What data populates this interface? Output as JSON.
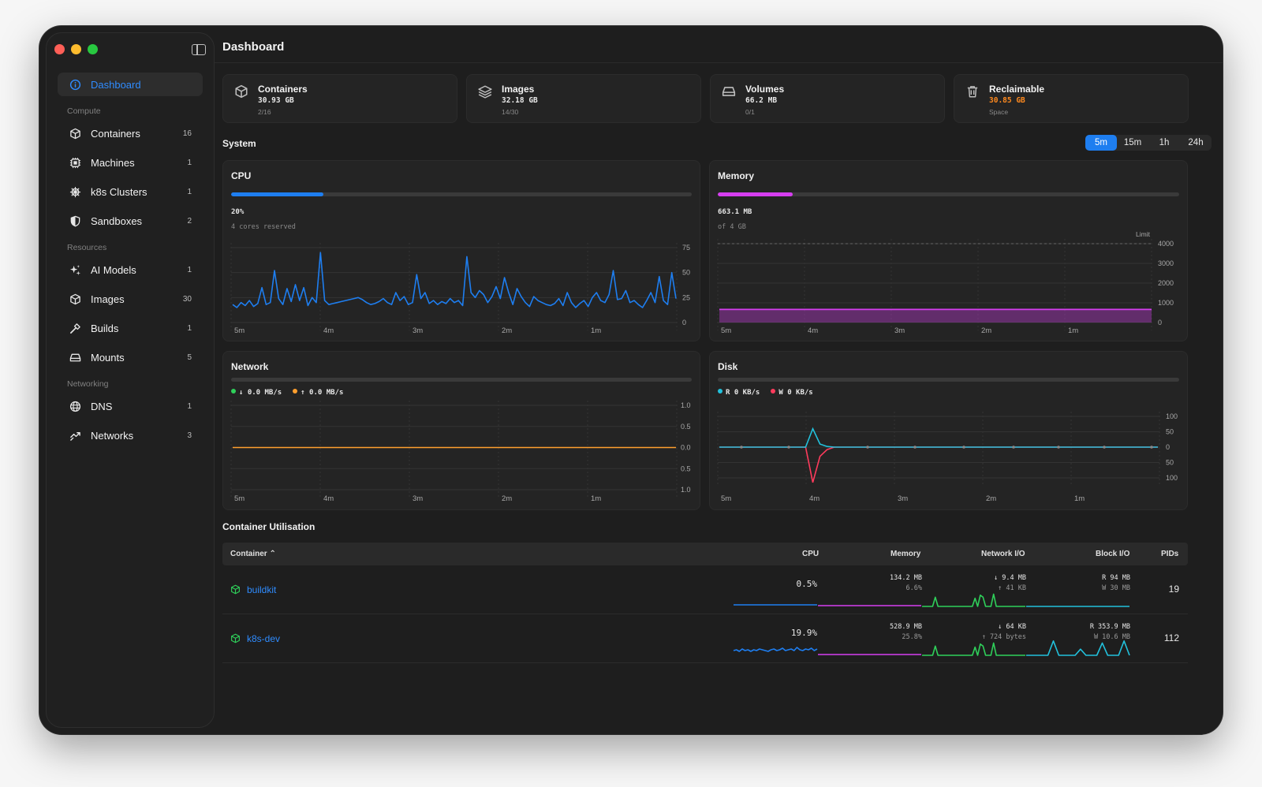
{
  "window": {
    "traffic_colors": [
      "#ff5f57",
      "#febc2e",
      "#28c840"
    ]
  },
  "sidebar": {
    "items": [
      {
        "key": "dashboard",
        "label": "Dashboard",
        "icon": "info-circle-icon",
        "count": "",
        "active": true
      }
    ],
    "sections": [
      {
        "title": "Compute",
        "items": [
          {
            "label": "Containers",
            "icon": "cube-icon",
            "count": "16"
          },
          {
            "label": "Machines",
            "icon": "chip-icon",
            "count": "1"
          },
          {
            "label": "k8s Clusters",
            "icon": "helm-wheel-icon",
            "count": "1"
          },
          {
            "label": "Sandboxes",
            "icon": "shield-icon",
            "count": "2"
          }
        ]
      },
      {
        "title": "Resources",
        "items": [
          {
            "label": "AI Models",
            "icon": "sparkles-icon",
            "count": "1"
          },
          {
            "label": "Images",
            "icon": "cube-outline-icon",
            "count": "30"
          },
          {
            "label": "Builds",
            "icon": "hammer-icon",
            "count": "1"
          },
          {
            "label": "Mounts",
            "icon": "drive-icon",
            "count": "5"
          }
        ]
      },
      {
        "title": "Networking",
        "items": [
          {
            "label": "DNS",
            "icon": "globe-icon",
            "count": "1"
          },
          {
            "label": "Networks",
            "icon": "network-arrows-icon",
            "count": "3"
          }
        ]
      }
    ]
  },
  "page": {
    "title": "Dashboard"
  },
  "stats": [
    {
      "title": "Containers",
      "value": "30.93 GB",
      "sub": "2/16",
      "icon": "cube-icon",
      "value_color": "#e8e8e8"
    },
    {
      "title": "Images",
      "value": "32.18 GB",
      "sub": "14/30",
      "icon": "layers-icon",
      "value_color": "#e8e8e8"
    },
    {
      "title": "Volumes",
      "value": "66.2 MB",
      "sub": "0/1",
      "icon": "drive-icon",
      "value_color": "#e8e8e8"
    },
    {
      "title": "Reclaimable",
      "value": "30.85 GB",
      "sub": "Space",
      "icon": "trash-icon",
      "value_color": "#ff8a1f"
    }
  ],
  "system": {
    "title": "System",
    "ranges": [
      "5m",
      "15m",
      "1h",
      "24h"
    ],
    "active_range": "5m",
    "time_ticks": [
      "5m",
      "4m",
      "3m",
      "2m",
      "1m"
    ]
  },
  "cpu": {
    "title": "CPU",
    "value": "20%",
    "sub": "4 cores reserved",
    "usage": 0.2,
    "color": "#1e7ef0",
    "chart_data": {
      "type": "line",
      "y_ticks": [
        "75",
        "50",
        "25",
        "0"
      ],
      "ylim": [
        0,
        75
      ],
      "values": [
        18,
        15,
        20,
        17,
        22,
        16,
        19,
        35,
        18,
        20,
        52,
        24,
        18,
        34,
        21,
        38,
        22,
        35,
        17,
        25,
        20,
        70,
        22,
        18,
        19,
        20,
        21,
        22,
        23,
        24,
        25,
        23,
        20,
        18,
        19,
        21,
        24,
        20,
        18,
        30,
        22,
        26,
        18,
        20,
        48,
        24,
        30,
        19,
        22,
        18,
        21,
        19,
        24,
        20,
        22,
        17,
        66,
        30,
        25,
        32,
        28,
        20,
        26,
        36,
        24,
        45,
        30,
        18,
        34,
        26,
        20,
        16,
        26,
        22,
        20,
        18,
        17,
        19,
        24,
        17,
        30,
        20,
        15,
        19,
        22,
        16,
        25,
        30,
        22,
        20,
        28,
        52,
        23,
        24,
        32,
        20,
        22,
        18,
        15,
        22,
        30,
        20,
        46,
        22,
        18,
        50,
        24
      ]
    }
  },
  "memory": {
    "title": "Memory",
    "value": "663.1 MB",
    "sub": "of 4 GB",
    "usage": 0.162,
    "color": "#d63ef0",
    "chart_data": {
      "type": "area",
      "y_ticks": [
        "4000",
        "3000",
        "2000",
        "1000",
        "0"
      ],
      "ylim": [
        0,
        4000
      ],
      "limit_label": "Limit",
      "limit": 4000,
      "values": [
        663.1,
        663.1
      ]
    }
  },
  "network": {
    "title": "Network",
    "legend": [
      {
        "label": "↓ 0.0 MB/s",
        "color": "#2fd05a"
      },
      {
        "label": "↑ 0.0 MB/s",
        "color": "#ff9f2e"
      }
    ],
    "chart_data": {
      "type": "line",
      "y_ticks": [
        "1.0",
        "0.5",
        "0.0",
        "0.5",
        "1.0"
      ],
      "ylim": [
        -1,
        1
      ],
      "series": [
        {
          "values": [
            0,
            0
          ],
          "color": "#ff9f2e"
        }
      ]
    }
  },
  "disk": {
    "title": "Disk",
    "legend": [
      {
        "label": "R 0 KB/s",
        "color": "#22c1dc"
      },
      {
        "label": "W 0 KB/s",
        "color": "#ff3b5c"
      }
    ],
    "chart_data": {
      "type": "line",
      "y_ticks": [
        "100",
        "50",
        "0",
        "50",
        "100"
      ],
      "ylim": [
        -100,
        100
      ],
      "read": [
        0,
        0,
        0,
        0,
        0,
        0,
        0,
        0,
        0,
        0,
        0,
        0,
        0,
        60,
        10,
        2,
        0,
        0,
        0,
        0,
        0,
        0,
        0,
        0,
        0,
        0,
        0,
        0,
        0,
        0,
        0,
        0,
        0,
        0,
        0,
        0,
        0,
        0,
        0,
        0,
        0,
        0,
        0,
        0,
        0,
        0,
        0,
        0,
        0,
        0,
        0,
        0,
        0,
        0,
        0,
        0,
        0,
        0,
        0,
        0,
        0,
        0
      ],
      "write": [
        0,
        0,
        0,
        0,
        0,
        0,
        0,
        0,
        0,
        0,
        0,
        0,
        0,
        -115,
        -30,
        -8,
        0,
        0,
        0,
        0,
        0,
        0,
        0,
        0,
        0,
        0,
        0,
        0,
        0,
        0,
        0,
        0,
        0,
        0,
        0,
        0,
        0,
        0,
        0,
        0,
        0,
        0,
        0,
        0,
        0,
        0,
        0,
        0,
        0,
        0,
        0,
        0,
        0,
        0,
        0,
        0,
        0,
        0,
        0,
        0,
        0,
        0
      ]
    }
  },
  "utilisation": {
    "title": "Container Utilisation",
    "columns": {
      "container": "Container ⌃",
      "cpu": "CPU",
      "memory": "Memory",
      "network": "Network I/O",
      "block": "Block I/O",
      "pids": "PIDs"
    },
    "rows": [
      {
        "name": "buildkit",
        "cpu": "0.5%",
        "mem": "134.2 MB",
        "mem_pct": "6.6%",
        "net_down": "↓ 9.4 MB",
        "net_up": "↑ 41 KB",
        "blk_r": "R 94 MB",
        "blk_w": "W 30 MB",
        "pids": "19",
        "cpu_spark": [
          1,
          1,
          1,
          1,
          1,
          1,
          1,
          1,
          1,
          1,
          1,
          1,
          1,
          1,
          1,
          1,
          1,
          1,
          1,
          1
        ],
        "mem_spark": [
          1,
          1,
          1,
          1,
          1,
          1,
          1,
          1,
          1,
          1
        ],
        "net_spark": [
          0,
          0,
          0,
          0,
          0,
          9,
          0,
          0,
          0,
          0,
          0,
          0,
          0,
          0,
          0,
          0,
          0,
          0,
          0,
          0,
          8,
          0,
          11,
          9,
          0,
          0,
          0,
          12,
          0,
          0,
          0,
          0,
          0,
          0,
          0,
          0,
          0,
          0,
          0,
          0
        ],
        "blk_spark": [
          0,
          0,
          0,
          0,
          0,
          0,
          0,
          0,
          0,
          0,
          0,
          0,
          0,
          0,
          0,
          0,
          0,
          0,
          0,
          0
        ]
      },
      {
        "name": "k8s-dev",
        "cpu": "19.9%",
        "mem": "528.9 MB",
        "mem_pct": "25.8%",
        "net_down": "↓ 64 KB",
        "net_up": "↑ 724 bytes",
        "blk_r": "R 353.9 MB",
        "blk_w": "W 10.6 MB",
        "pids": "112",
        "cpu_spark": [
          5,
          6,
          4,
          7,
          5,
          6,
          4,
          6,
          5,
          7,
          6,
          5,
          4,
          6,
          7,
          5,
          6,
          8,
          5,
          6,
          7,
          5,
          9,
          6,
          5,
          7,
          6,
          8,
          5,
          7
        ],
        "mem_spark": [
          1,
          1,
          1,
          1,
          1,
          1,
          1,
          1,
          1,
          1
        ],
        "net_spark": [
          0,
          0,
          0,
          0,
          0,
          9,
          0,
          0,
          0,
          0,
          0,
          0,
          0,
          0,
          0,
          0,
          0,
          0,
          0,
          0,
          8,
          0,
          11,
          9,
          0,
          0,
          0,
          12,
          0,
          0,
          0,
          0,
          0,
          0,
          0,
          0,
          0,
          0,
          0,
          0
        ],
        "blk_spark": [
          0,
          0,
          0,
          0,
          0,
          14,
          0,
          0,
          0,
          0,
          6,
          0,
          0,
          0,
          12,
          0,
          0,
          0,
          14,
          0
        ]
      }
    ]
  }
}
